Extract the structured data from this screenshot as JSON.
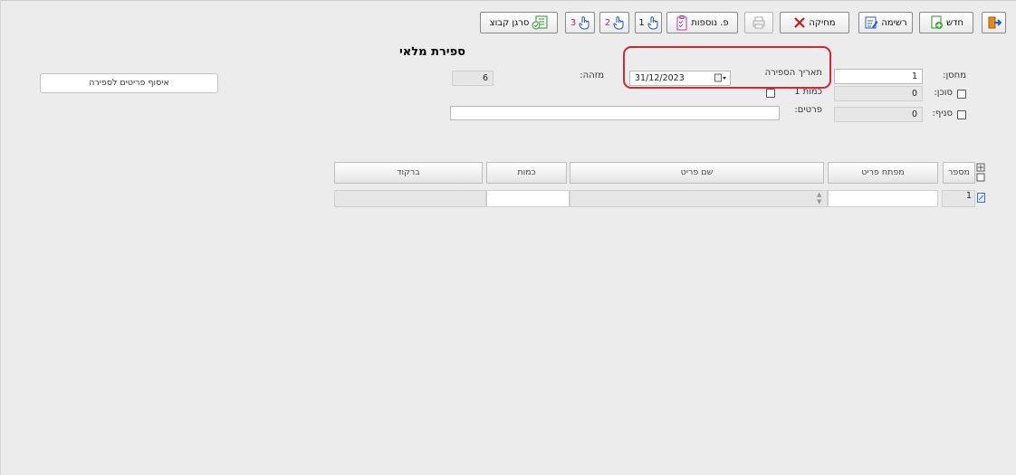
{
  "toolbar": {
    "exit_icon": "exit-door-icon",
    "new_label": "חדש",
    "list_label": "רשימה",
    "delete_label": "מחיקה",
    "print_icon": "printer-icon",
    "extra_label": "פ. נוספות",
    "step1_label": "1",
    "step2_label": "2",
    "step3_label": "3",
    "collect_label": "סרגן קבוצ"
  },
  "page": {
    "title": "ספירת מלאי",
    "identity_label": "מזהה:",
    "identity_value": "6",
    "load_items_button": "איסוף פריטים לספירה"
  },
  "form": {
    "warehouse_label": "מחסן:",
    "warehouse_value": "1",
    "agent_label": "סוכן:",
    "agent_value": "0",
    "branch_label": "סניף:",
    "branch_value": "0",
    "count_date_label": "תאריך הספירה",
    "count_date_value": "31/12/2023",
    "quantity_label": "כמות 1",
    "details_label": "פרטים:",
    "details_value": ""
  },
  "table": {
    "headers": {
      "number": "מספר",
      "item_key": "מפתח פריט",
      "item_name": "שם פריט",
      "quantity": "כמות",
      "barcode": "ברקוד"
    },
    "rows": [
      {
        "number": "1",
        "item_key": "",
        "item_name": "",
        "quantity": "",
        "barcode": ""
      }
    ]
  },
  "colors": {
    "background": "#ececec",
    "highlight_border": "#d6262f",
    "delete_x": "#d01818"
  }
}
